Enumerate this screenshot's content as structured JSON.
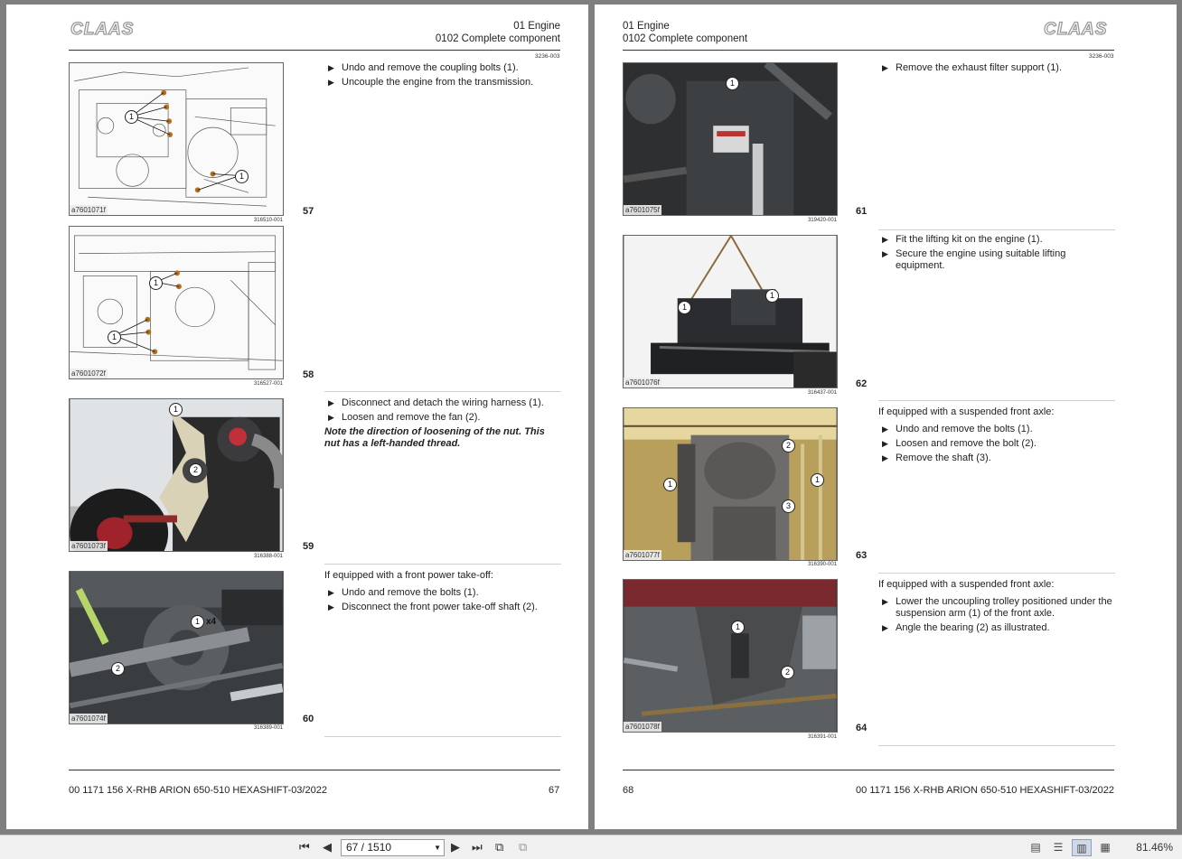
{
  "left_page": {
    "logo": "CLAAS",
    "header_line1": "01 Engine",
    "header_line2": "0102 Complete component",
    "doc_id": "3236-003",
    "figures": [
      {
        "code": "a7601071f",
        "ref": "316510-001",
        "step": "57",
        "callouts": [
          "1",
          "1"
        ]
      },
      {
        "code": "a7601072f",
        "ref": "316527-001",
        "step": "58",
        "callouts": [
          "1",
          "1"
        ]
      },
      {
        "code": "a7601073f",
        "ref": "316388-001",
        "step": "59",
        "callouts": [
          "1",
          "2"
        ]
      },
      {
        "code": "a7601074f",
        "ref": "316389-001",
        "step": "60",
        "callouts": [
          "1",
          "2"
        ],
        "qty": "x4"
      }
    ],
    "blocks": [
      {
        "items": [
          "Undo and remove the coupling bolts (1).",
          "Uncouple the engine from the transmission."
        ]
      },
      {
        "items": [
          "Disconnect and detach the wiring harness (1).",
          "Loosen and remove the fan (2)."
        ],
        "note": "Note the direction of loosening of the nut. This nut has a left-handed thread."
      },
      {
        "intro": "If equipped with a front power take-off:",
        "items": [
          "Undo and remove the bolts (1).",
          "Disconnect the front power take-off shaft (2)."
        ]
      }
    ],
    "footer_title": "00 1171 156 X-RHB ARION 650-510 HEXASHIFT-03/2022",
    "page_number": "67"
  },
  "right_page": {
    "logo": "CLAAS",
    "header_line1": "01 Engine",
    "header_line2": "0102 Complete component",
    "doc_id": "3236-003",
    "figures": [
      {
        "code": "a7601075f",
        "ref": "319420-001",
        "step": "61",
        "callouts": [
          "1"
        ]
      },
      {
        "code": "a7601076f",
        "ref": "316437-001",
        "step": "62",
        "callouts": [
          "1",
          "1"
        ]
      },
      {
        "code": "a7601077f",
        "ref": "316390-001",
        "step": "63",
        "callouts": [
          "2",
          "1",
          "1",
          "3"
        ]
      },
      {
        "code": "a7601078f",
        "ref": "316391-001",
        "step": "64",
        "callouts": [
          "1",
          "2"
        ]
      }
    ],
    "blocks": [
      {
        "items": [
          "Remove the exhaust filter support (1)."
        ]
      },
      {
        "items": [
          "Fit the lifting kit on the engine (1).",
          "Secure the engine using suitable lifting equipment."
        ]
      },
      {
        "intro": "If equipped with a suspended front axle:",
        "items": [
          "Undo and remove the bolts (1).",
          "Loosen and remove the bolt (2).",
          "Remove the shaft (3)."
        ]
      },
      {
        "intro": "If equipped with a suspended front axle:",
        "items": [
          "Lower the uncoupling trolley positioned under the suspension arm (1) of the front axle.",
          "Angle the bearing (2) as illustrated."
        ]
      }
    ],
    "footer_title": "00 1171 156 X-RHB ARION 650-510 HEXASHIFT-03/2022",
    "page_number": "68"
  },
  "toolbar": {
    "first_page_icon": "first-page-icon",
    "prev_page_icon": "previous-page-icon",
    "page_field": "67 / 1510",
    "next_page_icon": "next-page-icon",
    "last_page_icon": "last-page-icon",
    "zoom": "81.46%"
  },
  "colors": {
    "viewer_background": "#7f7f7f",
    "page": "#ffffff",
    "logo": "#9a9a9a"
  }
}
